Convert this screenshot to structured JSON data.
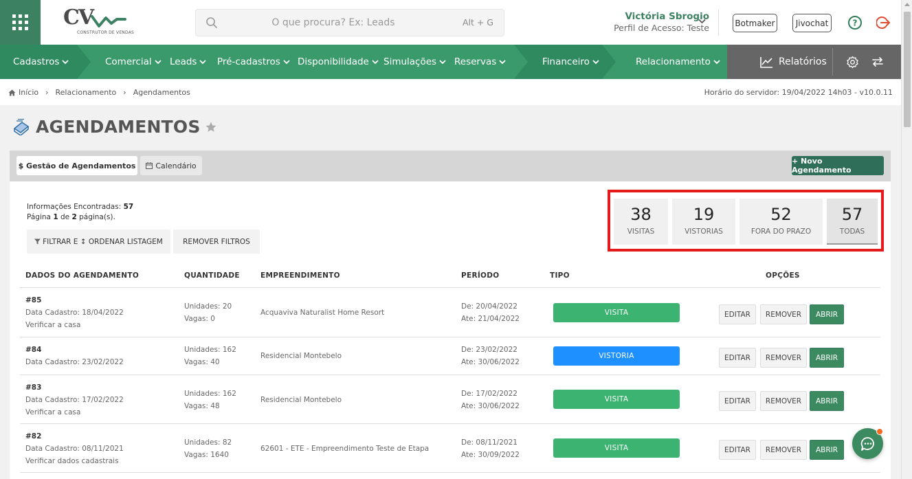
{
  "header": {
    "logo_text": "CV",
    "logo_sub": "CONSTRUTOR DE VENDAS",
    "search_placeholder": "O que procura? Ex: Leads",
    "search_shortcut": "Alt + G",
    "user_name": "Victória Sbrogio",
    "user_profile": "Perfil de Acesso: Teste",
    "btn_botmaker": "Botmaker",
    "btn_jivochat": "Jivochat"
  },
  "nav": {
    "items": [
      "Cadastros",
      "Comercial",
      "Leads",
      "Pré-cadastros",
      "Disponibilidade",
      "Simulações",
      "Reservas",
      "Financeiro",
      "Relacionamento"
    ],
    "reports": "Relatórios",
    "colors": {
      "green": "#3a9a6b",
      "dark_green": "#2f7f58",
      "gray": "#666666"
    }
  },
  "breadcrumb": {
    "items": [
      "Início",
      "Relacionamento",
      "Agendamentos"
    ],
    "server_time": "Horário do servidor: 19/04/2022 14h03 - v10.0.11"
  },
  "page": {
    "title": "AGENDAMENTOS"
  },
  "tabs": {
    "gestao": "$ Gestão de Agendamentos",
    "calendario": "Calendário"
  },
  "new_button": "+ Novo Agendamento",
  "info": {
    "found_label": "Informações Encontradas:",
    "found_count": "57",
    "page_prefix": "Página",
    "page_current": "1",
    "page_of": "de",
    "page_total": "2",
    "page_suffix": "página(s)."
  },
  "filters": {
    "filter_order": "FILTRAR E ↕ ORDENAR LISTAGEM",
    "remove": "REMOVER FILTROS"
  },
  "stats": [
    {
      "value": "38",
      "label": "VISITAS"
    },
    {
      "value": "19",
      "label": "VISTORIAS"
    },
    {
      "value": "52",
      "label": "FORA DO PRAZO"
    },
    {
      "value": "57",
      "label": "TODAS"
    }
  ],
  "table": {
    "headers": [
      "DADOS DO AGENDAMENTO",
      "QUANTIDADE",
      "EMPREENDIMENTO",
      "PERÍODO",
      "TIPO",
      "OPÇÕES"
    ],
    "rows": [
      {
        "id": "#85",
        "cadastro": "Data Cadastro: 18/04/2022",
        "desc": "Verificar a casa",
        "unidades": "Unidades: 20",
        "vagas": "Vagas: 0",
        "empreendimento": "Acquaviva Naturalist Home Resort",
        "de": "De: 20/04/2022",
        "ate": "Ate: 21/04/2022",
        "tipo": "VISITA",
        "tipo_color": "#3cb371"
      },
      {
        "id": "#84",
        "cadastro": "Data Cadastro: 23/02/2022",
        "desc": "",
        "unidades": "Unidades: 162",
        "vagas": "Vagas: 40",
        "empreendimento": "Residencial Montebelo",
        "de": "De: 23/02/2022",
        "ate": "Ate: 30/06/2022",
        "tipo": "VISTORIA",
        "tipo_color": "#1e90ff"
      },
      {
        "id": "#83",
        "cadastro": "Data Cadastro: 17/02/2022",
        "desc": "Verificar a casa",
        "unidades": "Unidades: 162",
        "vagas": "Vagas: 48",
        "empreendimento": "Residencial Montebelo",
        "de": "De: 17/02/2022",
        "ate": "Ate: 30/06/2022",
        "tipo": "VISITA",
        "tipo_color": "#3cb371"
      },
      {
        "id": "#82",
        "cadastro": "Data Cadastro: 08/11/2021",
        "desc": "Verificar dados cadastrais",
        "unidades": "Unidades: 82",
        "vagas": "Vagas: 1640",
        "empreendimento": "62601 - ETE - Empreendimento Teste de Etapa",
        "de": "De: 08/11/2021",
        "ate": "Ate: 30/09/2022",
        "tipo": "VISITA",
        "tipo_color": "#3cb371"
      }
    ],
    "options": {
      "edit": "EDITAR",
      "remove": "REMOVER",
      "open": "ABRIR"
    }
  }
}
